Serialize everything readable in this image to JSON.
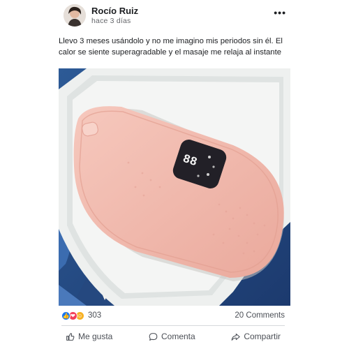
{
  "post": {
    "author": "Rocío Ruiz",
    "time": "hace 3 días",
    "more_icon": "•••",
    "text": "Llevo 3 meses usándolo y no me imagino mis periodos sin él. El calor se siente superagradable y el masaje me relaja al instante",
    "photo": {
      "subject": "pink-heating-belt-in-box",
      "display_text": "88",
      "colors": {
        "device": "#f1b8ab",
        "box": "#eef0ef",
        "fabric": "#2a4f8a",
        "display": "#222027"
      }
    }
  },
  "stats": {
    "reaction_count": "303",
    "comments": "20 Comments",
    "reaction_icons": [
      "like-icon",
      "love-icon",
      "care-icon"
    ]
  },
  "actions": {
    "like": "Me gusta",
    "comment": "Comenta",
    "share": "Compartir"
  },
  "colors": {
    "like": "#1877f2",
    "love": "#f33e58",
    "care": "#f7b125",
    "muted": "#65676b"
  }
}
